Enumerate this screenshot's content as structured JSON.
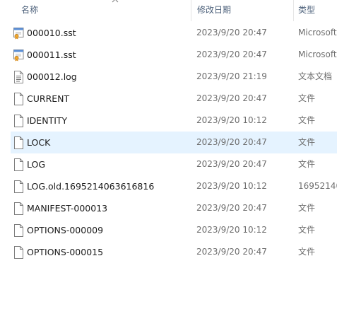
{
  "header": {
    "name_label": "名称",
    "date_label": "修改日期",
    "type_label": "类型"
  },
  "files": [
    {
      "name": "000010.sst",
      "date": "2023/9/20 20:47",
      "type": "Microsoft",
      "icon": "sst-file-icon"
    },
    {
      "name": "000011.sst",
      "date": "2023/9/20 20:47",
      "type": "Microsoft",
      "icon": "sst-file-icon"
    },
    {
      "name": "000012.log",
      "date": "2023/9/20 21:19",
      "type": "文本文档",
      "icon": "text-file-icon"
    },
    {
      "name": "CURRENT",
      "date": "2023/9/20 20:47",
      "type": "文件",
      "icon": "blank-file-icon"
    },
    {
      "name": "IDENTITY",
      "date": "2023/9/20 10:12",
      "type": "文件",
      "icon": "blank-file-icon"
    },
    {
      "name": "LOCK",
      "date": "2023/9/20 20:47",
      "type": "文件",
      "icon": "blank-file-icon",
      "selected": true
    },
    {
      "name": "LOG",
      "date": "2023/9/20 20:47",
      "type": "文件",
      "icon": "blank-file-icon"
    },
    {
      "name": "LOG.old.1695214063616816",
      "date": "2023/9/20 10:12",
      "type": "16952140",
      "icon": "blank-file-icon"
    },
    {
      "name": "MANIFEST-000013",
      "date": "2023/9/20 20:47",
      "type": "文件",
      "icon": "blank-file-icon"
    },
    {
      "name": "OPTIONS-000009",
      "date": "2023/9/20 10:12",
      "type": "文件",
      "icon": "blank-file-icon"
    },
    {
      "name": "OPTIONS-000015",
      "date": "2023/9/20 20:47",
      "type": "文件",
      "icon": "blank-file-icon"
    }
  ],
  "colors": {
    "selection": "#e5f3ff",
    "header_text": "#4c607a",
    "secondary_text": "#6d6d6d"
  }
}
